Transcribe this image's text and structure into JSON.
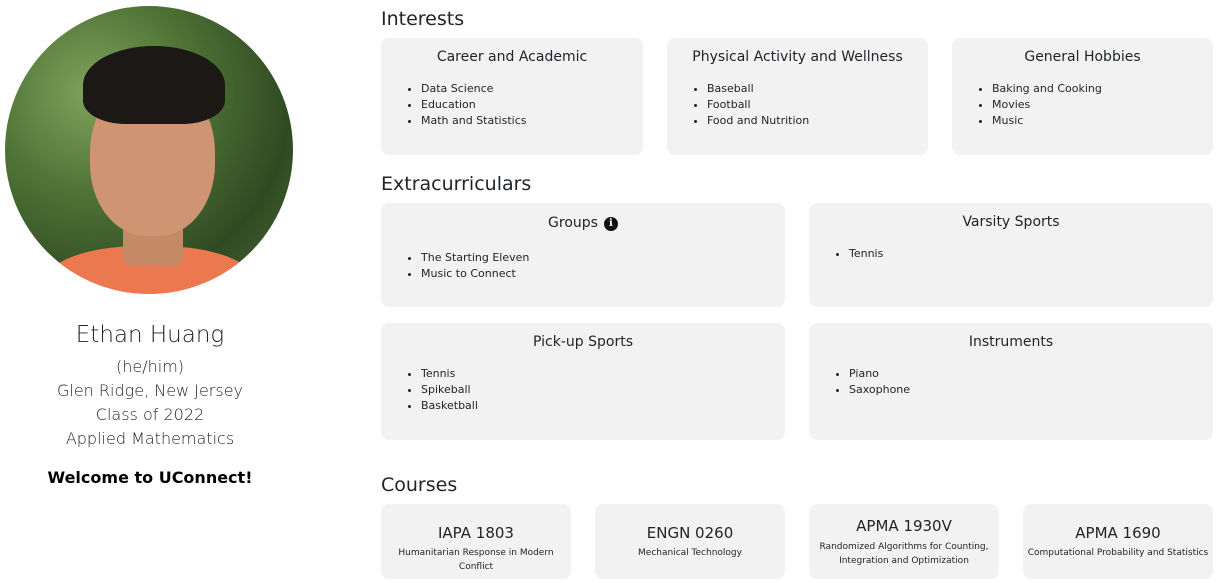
{
  "profile": {
    "name": "Ethan Huang",
    "pronouns": "(he/him)",
    "hometown": "Glen Ridge, New Jersey",
    "class_year": "Class of 2022",
    "major": "Applied Mathematics",
    "welcome": "Welcome to UConnect!"
  },
  "interests": {
    "title": "Interests",
    "cards": [
      {
        "title": "Career and Academic",
        "items": [
          "Data Science",
          "Education",
          "Math and Statistics"
        ]
      },
      {
        "title": "Physical Activity and Wellness",
        "items": [
          "Baseball",
          "Football",
          "Food and Nutrition"
        ]
      },
      {
        "title": "General Hobbies",
        "items": [
          "Baking and Cooking",
          "Movies",
          "Music"
        ]
      }
    ]
  },
  "extracurriculars": {
    "title": "Extracurriculars",
    "cards": [
      {
        "title": "Groups",
        "items": [
          "The Starting Eleven",
          "Music to Connect"
        ]
      },
      {
        "title": "Varsity Sports",
        "items": [
          "Tennis"
        ]
      },
      {
        "title": "Pick-up Sports",
        "items": [
          "Tennis",
          "Spikeball",
          "Basketball"
        ]
      },
      {
        "title": "Instruments",
        "items": [
          "Piano",
          "Saxophone"
        ]
      }
    ]
  },
  "courses": {
    "title": "Courses",
    "cards": [
      {
        "code": "IAPA 1803",
        "name": "Humanitarian Response in Modern Conflict"
      },
      {
        "code": "ENGN 0260",
        "name": "Mechanical Technology"
      },
      {
        "code": "APMA 1930V",
        "name": "Randomized Algorithms for Counting, Integration and Optimization"
      },
      {
        "code": "APMA 1690",
        "name": "Computational Probability and Statistics"
      }
    ]
  },
  "icons": {
    "groups_info": "info-icon"
  }
}
